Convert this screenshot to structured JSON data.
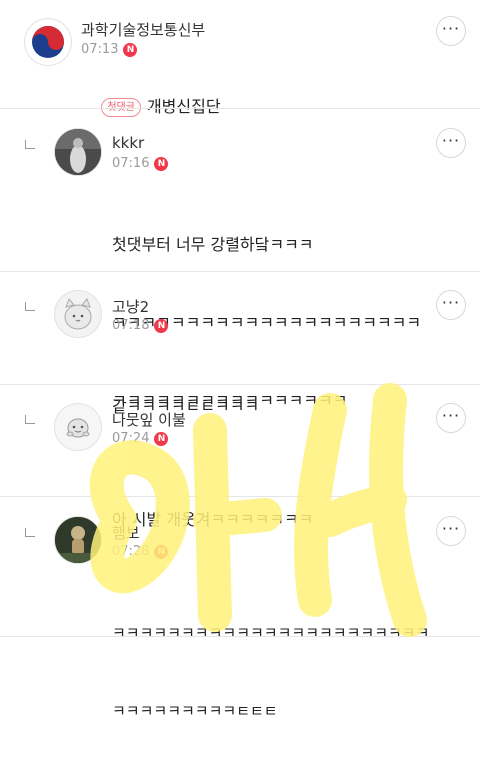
{
  "comments": [
    {
      "author": "과학기술정보통신부",
      "time": "07:13",
      "new_badge": "N",
      "first_label": "첫댓글",
      "text": "개병신집단"
    },
    {
      "author": "kkkr",
      "time": "07:16",
      "new_badge": "N",
      "text_lines": [
        "첫댓부터 너무 강렬하닼ㅋㅋㅋ",
        "ㅋㅋㅋㅋㅋㅋㅋㅋㅋㅋㅋㅋㅋㅋㅋㅋㅋㅋㅋㅋㅋ",
        "ㅋㅋㅋㅋㅋㅋㅋㅋㅋㅋㅋㅋㅋㅋㅋㅋ"
      ]
    },
    {
      "author": "고냥2",
      "time": "07:18",
      "new_badge": "N",
      "text": "같ㅋㅋㅋㅋㅌㅌㅋㅋㅋ"
    },
    {
      "author": "나뭇잎 이불",
      "time": "07:24",
      "new_badge": "N",
      "text": "아 시발 개웃겨ㅋㅋㅋㅋㅋㅋㅋ"
    },
    {
      "author": "햄보",
      "time": "07:28",
      "new_badge": "N",
      "text_lines": [
        "ㅋㅋㅋㅋㅋㅋㅋㅋㅋㅋㅋㅋㅋㅋㅋㅋㅋㅋㅋㅋㅋㅋㅋ",
        "ㅋㅋㅋㅋㅋㅋㅋㅋㅋㅌㅌㅌ"
      ]
    }
  ],
  "more_icon_label": "···",
  "colors": {
    "badge": "#f0394a",
    "watermark": "#fff27a"
  }
}
